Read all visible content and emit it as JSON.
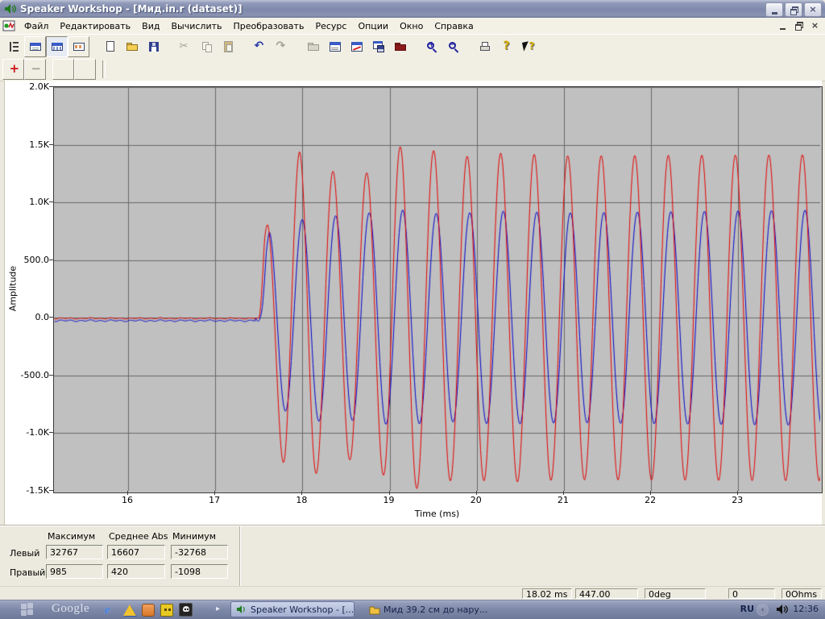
{
  "window": {
    "title": "Speaker Workshop - [Мид.in.r (dataset)]"
  },
  "menu": {
    "items": [
      "Файл",
      "Редактировать",
      "Вид",
      "Вычислить",
      "Преобразовать",
      "Ресурс",
      "Опции",
      "Окно",
      "Справка"
    ]
  },
  "toolbar": {
    "groups": [
      [
        {
          "name": "sort-tree",
          "icon": "tree",
          "state": "flat"
        },
        {
          "name": "datasheet-view",
          "icon": "winlist",
          "state": "raised"
        },
        {
          "name": "chart-view",
          "icon": "wingrid",
          "state": "pressed"
        },
        {
          "name": "notes-view",
          "icon": "wincells",
          "state": "raised"
        }
      ],
      [
        {
          "name": "new",
          "icon": "docnew",
          "state": "flat"
        },
        {
          "name": "open",
          "icon": "folderopen",
          "state": "flat"
        },
        {
          "name": "save",
          "icon": "floppy",
          "state": "flat"
        }
      ],
      [
        {
          "name": "cut",
          "icon": "cut",
          "glyph": "✂",
          "state": "disabled"
        },
        {
          "name": "copy",
          "icon": "copy",
          "state": "disabled"
        },
        {
          "name": "paste",
          "icon": "paste",
          "state": "disabled"
        }
      ],
      [
        {
          "name": "undo",
          "icon": "undo",
          "glyph": "↶",
          "state": "flat"
        },
        {
          "name": "redo",
          "icon": "redo",
          "glyph": "↷",
          "state": "disabled"
        }
      ],
      [
        {
          "name": "open-resource",
          "icon": "folderdis",
          "state": "disabled"
        },
        {
          "name": "properties-window",
          "icon": "winprop",
          "state": "flat"
        },
        {
          "name": "chart-window",
          "icon": "winchart",
          "state": "flat"
        },
        {
          "name": "save-window",
          "icon": "winfloppy",
          "state": "flat"
        },
        {
          "name": "export",
          "icon": "folderred",
          "state": "flat"
        }
      ],
      [
        {
          "name": "zoom-in",
          "icon": "zoom",
          "glyph": "+",
          "state": "flat"
        },
        {
          "name": "zoom-out",
          "icon": "zoom",
          "glyph": "−",
          "state": "flat"
        }
      ],
      [
        {
          "name": "print",
          "icon": "print",
          "state": "flat"
        },
        {
          "name": "help",
          "icon": "help",
          "glyph": "?",
          "state": "flat"
        },
        {
          "name": "context-help",
          "icon": "helparrow",
          "glyph": "?",
          "state": "flat"
        }
      ]
    ],
    "row2": [
      {
        "name": "add-marker",
        "icon": "plus",
        "glyph": "+",
        "state": "raised"
      },
      {
        "name": "remove-marker",
        "icon": "minus",
        "glyph": "−",
        "state": "raised"
      },
      {
        "name": "blank-1",
        "icon": "none",
        "state": "raised"
      },
      {
        "name": "blank-2",
        "icon": "none",
        "state": "raised"
      }
    ]
  },
  "chart_data": {
    "type": "line",
    "title": "",
    "xlabel": "Time (ms)",
    "ylabel": "Amplitude",
    "x_range": [
      15.15,
      23.94
    ],
    "y_range": [
      -1500,
      2000
    ],
    "x_ticks": [
      16,
      17,
      18,
      19,
      20,
      21,
      22,
      23
    ],
    "y_ticks": [
      {
        "value": 2000,
        "label": "2.0K"
      },
      {
        "value": 1500,
        "label": "1.5K"
      },
      {
        "value": 1000,
        "label": "1.0K"
      },
      {
        "value": 500,
        "label": "500.0"
      },
      {
        "value": 0,
        "label": "0.0"
      },
      {
        "value": -500,
        "label": "-500.0"
      },
      {
        "value": -1000,
        "label": "-1.0K"
      },
      {
        "value": -1500,
        "label": "-1.5K"
      }
    ],
    "plot_bg": "#c0c0c0",
    "grid_color": "#686868",
    "legend": "none",
    "description": "Tone-burst response: flat near 0 until ~17.5 ms, then ~2.6 kHz sine waves; red (left) amplitude ~1400, blue (right) amplitude ~920",
    "series": [
      {
        "name": "right-channel",
        "color": "#0000cc",
        "onset_ms": 17.46,
        "baseline": -25,
        "noise_amp": 5,
        "freq_khz": 2.6,
        "peak_ref_ms": 20.3,
        "envelope": [
          [
            17.46,
            0
          ],
          [
            17.53,
            200
          ],
          [
            17.58,
            620
          ],
          [
            17.62,
            760
          ],
          [
            17.75,
            800
          ],
          [
            17.95,
            840
          ],
          [
            18.15,
            900
          ],
          [
            18.45,
            880
          ],
          [
            18.8,
            915
          ],
          [
            19.15,
            935
          ],
          [
            19.6,
            900
          ],
          [
            20.3,
            925
          ],
          [
            21.0,
            910
          ],
          [
            23.94,
            935
          ]
        ]
      },
      {
        "name": "left-channel",
        "color": "#e60000",
        "onset_ms": 17.5,
        "baseline": -5,
        "noise_amp": 4,
        "freq_khz": 2.6,
        "peak_ref_ms": 20.27,
        "envelope": [
          [
            17.5,
            0
          ],
          [
            17.56,
            700
          ],
          [
            17.6,
            860
          ],
          [
            17.7,
            1050
          ],
          [
            17.79,
            1300
          ],
          [
            17.96,
            1440
          ],
          [
            18.2,
            1330
          ],
          [
            18.45,
            1230
          ],
          [
            18.7,
            1240
          ],
          [
            18.95,
            1380
          ],
          [
            19.15,
            1505
          ],
          [
            19.45,
            1460
          ],
          [
            19.8,
            1395
          ],
          [
            20.3,
            1430
          ],
          [
            21.0,
            1405
          ],
          [
            23.94,
            1415
          ]
        ]
      }
    ]
  },
  "stats": {
    "col_headers": [
      "Максимум",
      "Среднее Abs",
      "Минимум"
    ],
    "rows": [
      {
        "label": "Левый",
        "values": [
          "32767",
          "16607",
          "-32768"
        ]
      },
      {
        "label": "Правый",
        "values": [
          "985",
          "420",
          "-1098"
        ]
      }
    ]
  },
  "status_bar": {
    "fields": [
      "18.02  ms",
      "447.00",
      "0deg",
      "0",
      "0Ohms"
    ]
  },
  "taskbar": {
    "google_label": "Google",
    "tasks": [
      {
        "label": "Speaker Workshop - [...",
        "active": true,
        "icon": "speaker"
      },
      {
        "label": "Мид 39.2 см до нару...",
        "active": false,
        "icon": "folder"
      }
    ],
    "language": "RU",
    "clock": "12:36"
  }
}
